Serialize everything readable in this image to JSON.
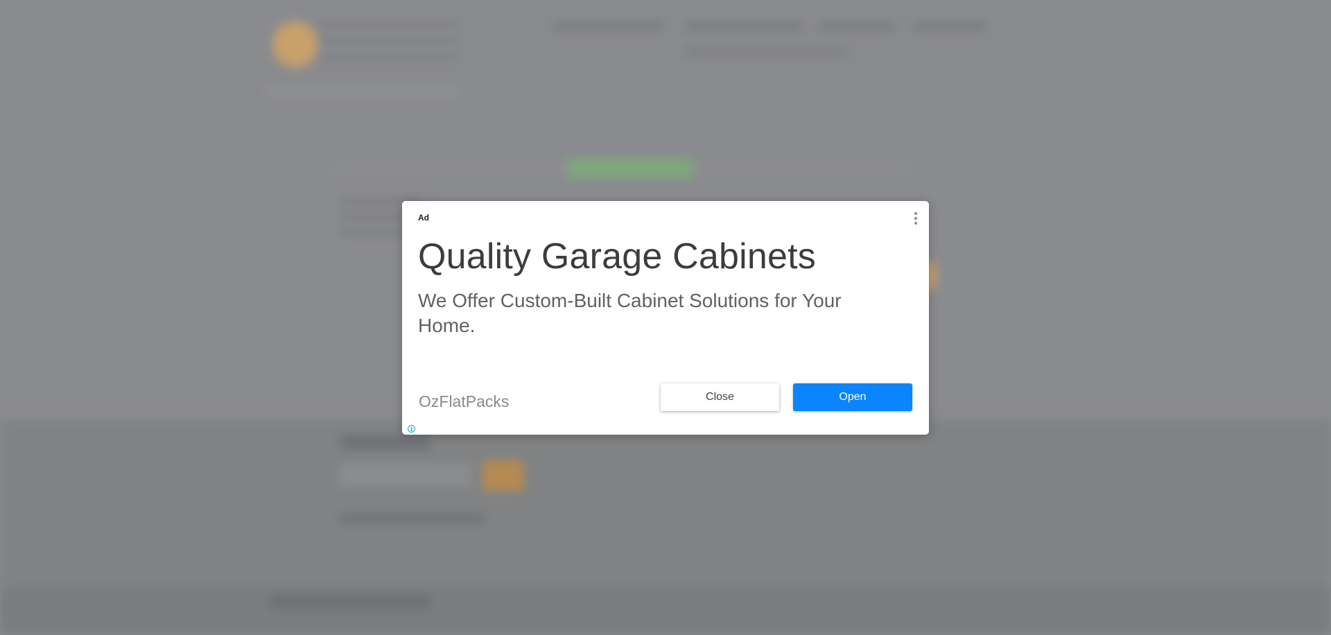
{
  "ad": {
    "label": "Ad",
    "headline": "Quality Garage Cabinets",
    "description": "We Offer Custom-Built Cabinet Solutions for Your Home.",
    "advertiser": "OzFlatPacks",
    "close_label": "Close",
    "open_label": "Open",
    "info_glyph": "i",
    "colors": {
      "open_button": "#0a84ff",
      "info_icon": "#1aa1c9",
      "overlay": "#8a8b8f"
    },
    "icons": [
      "more-vert-icon",
      "adchoices-info-icon"
    ]
  }
}
